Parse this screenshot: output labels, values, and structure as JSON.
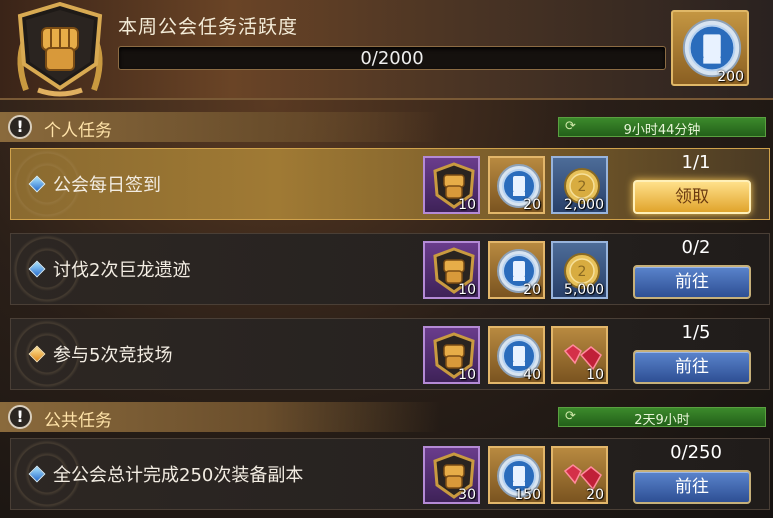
{
  "header": {
    "title": "本周公会任务活跃度",
    "progress_text": "0/2000",
    "progress_fraction": 0,
    "chest_qty": "200"
  },
  "sections": [
    {
      "label": "个人任务",
      "timer": "9小时44分钟"
    },
    {
      "label": "公共任务",
      "timer": "2天9小时"
    }
  ],
  "tasks": [
    {
      "name": "公会每日签到",
      "progress": "1/1",
      "button": "领取",
      "highlight": true,
      "rewards": [
        {
          "icon": "fist-token-icon",
          "qty": "10"
        },
        {
          "icon": "blue-medal-icon",
          "qty": "20"
        },
        {
          "icon": "gold-coin-icon",
          "qty": "2,000"
        }
      ]
    },
    {
      "name": "讨伐2次巨龙遗迹",
      "progress": "0/2",
      "button": "前往",
      "highlight": false,
      "rewards": [
        {
          "icon": "fist-token-icon",
          "qty": "10"
        },
        {
          "icon": "blue-medal-icon",
          "qty": "20"
        },
        {
          "icon": "gold-coin-icon",
          "qty": "5,000"
        }
      ]
    },
    {
      "name": "参与5次竞技场",
      "progress": "1/5",
      "button": "前往",
      "highlight": false,
      "rewards": [
        {
          "icon": "fist-token-icon",
          "qty": "10"
        },
        {
          "icon": "blue-medal-icon",
          "qty": "40"
        },
        {
          "icon": "red-gem-icon",
          "qty": "10"
        }
      ]
    },
    {
      "name": "全公会总计完成250次装备副本",
      "progress": "0/250",
      "button": "前往",
      "highlight": false,
      "rewards": [
        {
          "icon": "fist-token-icon",
          "qty": "30"
        },
        {
          "icon": "blue-medal-icon",
          "qty": "150"
        },
        {
          "icon": "red-gem-icon",
          "qty": "20"
        }
      ]
    }
  ],
  "colors": {
    "claim_button": "#f0b840",
    "go_button": "#3a5ea8",
    "timer_bar": "#2f7a24",
    "accent_gold": "#e2b66a"
  }
}
